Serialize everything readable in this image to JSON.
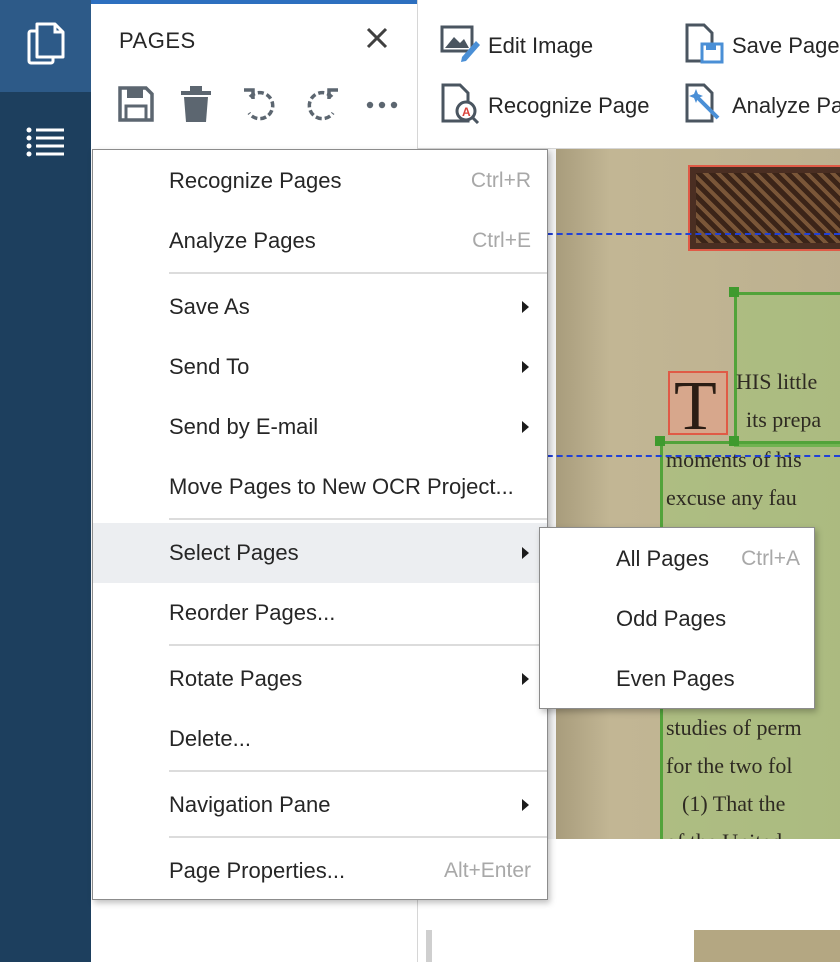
{
  "pages_panel": {
    "title": "PAGES",
    "tools": [
      "save-icon",
      "delete-icon",
      "undo-icon",
      "redo-icon",
      "more-icon"
    ]
  },
  "toolbar": {
    "edit_image": "Edit Image",
    "save_page": "Save Page",
    "recognize_page": "Recognize Page",
    "analyze_page": "Analyze Pa"
  },
  "document": {
    "lines": [
      "HIS little",
      "its prepa",
      "moments of his",
      "excuse any fau",
      "studies of perm",
      "for the two fol",
      "(1) That the",
      "of the United"
    ],
    "drop_cap": "T"
  },
  "context_menu": {
    "items": [
      {
        "label": "Recognize Pages",
        "shortcut": "Ctrl+R"
      },
      {
        "label": "Analyze Pages",
        "shortcut": "Ctrl+E"
      },
      {
        "label": "Save As",
        "submenu": true
      },
      {
        "label": "Send To",
        "submenu": true
      },
      {
        "label": "Send by E-mail",
        "submenu": true
      },
      {
        "label": "Move Pages to New OCR Project..."
      },
      {
        "label": "Select Pages",
        "submenu": true,
        "highlighted": true
      },
      {
        "label": "Reorder Pages..."
      },
      {
        "label": "Rotate Pages",
        "submenu": true
      },
      {
        "label": "Delete..."
      },
      {
        "label": "Navigation Pane",
        "submenu": true
      },
      {
        "label": "Page Properties...",
        "shortcut": "Alt+Enter"
      }
    ]
  },
  "submenu": {
    "items": [
      {
        "label": "All Pages",
        "shortcut": "Ctrl+A"
      },
      {
        "label": "Odd Pages"
      },
      {
        "label": "Even Pages"
      }
    ]
  },
  "colors": {
    "rail": "#1d3f5e",
    "rail_active": "#2d5a88",
    "accent": "#2d6fbf",
    "menu_highlight": "#eceef1",
    "region_green": "#52a33a",
    "region_red": "#e05a46"
  }
}
